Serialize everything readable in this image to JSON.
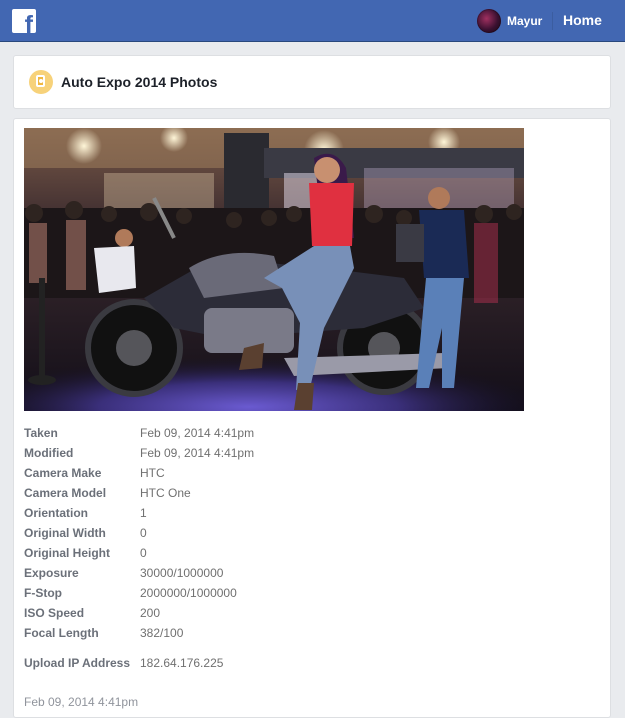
{
  "header": {
    "logo": "facebook-f-logo",
    "user_name": "Mayur",
    "home_label": "Home",
    "brand_color": "#4267b2"
  },
  "album": {
    "title": "Auto Expo 2014 Photos",
    "icon": "photo-album-icon"
  },
  "photo": {
    "alt": "Woman seated on a motorcycle at Auto Expo 2014 exhibition stand"
  },
  "metadata": [
    {
      "label": "Taken",
      "value": "Feb 09, 2014 4:41pm"
    },
    {
      "label": "Modified",
      "value": "Feb 09, 2014 4:41pm"
    },
    {
      "label": "Camera Make",
      "value": "HTC"
    },
    {
      "label": "Camera Model",
      "value": "HTC One"
    },
    {
      "label": "Orientation",
      "value": "1"
    },
    {
      "label": "Original Width",
      "value": "0"
    },
    {
      "label": "Original Height",
      "value": "0"
    },
    {
      "label": "Exposure",
      "value": "30000/1000000"
    },
    {
      "label": "F-Stop",
      "value": "2000000/1000000"
    },
    {
      "label": "ISO Speed",
      "value": "200"
    },
    {
      "label": "Focal Length",
      "value": "382/100"
    },
    {
      "label": "Upload IP Address",
      "value": "182.64.176.225"
    }
  ],
  "footer": {
    "date": "Feb 09, 2014 4:41pm"
  }
}
